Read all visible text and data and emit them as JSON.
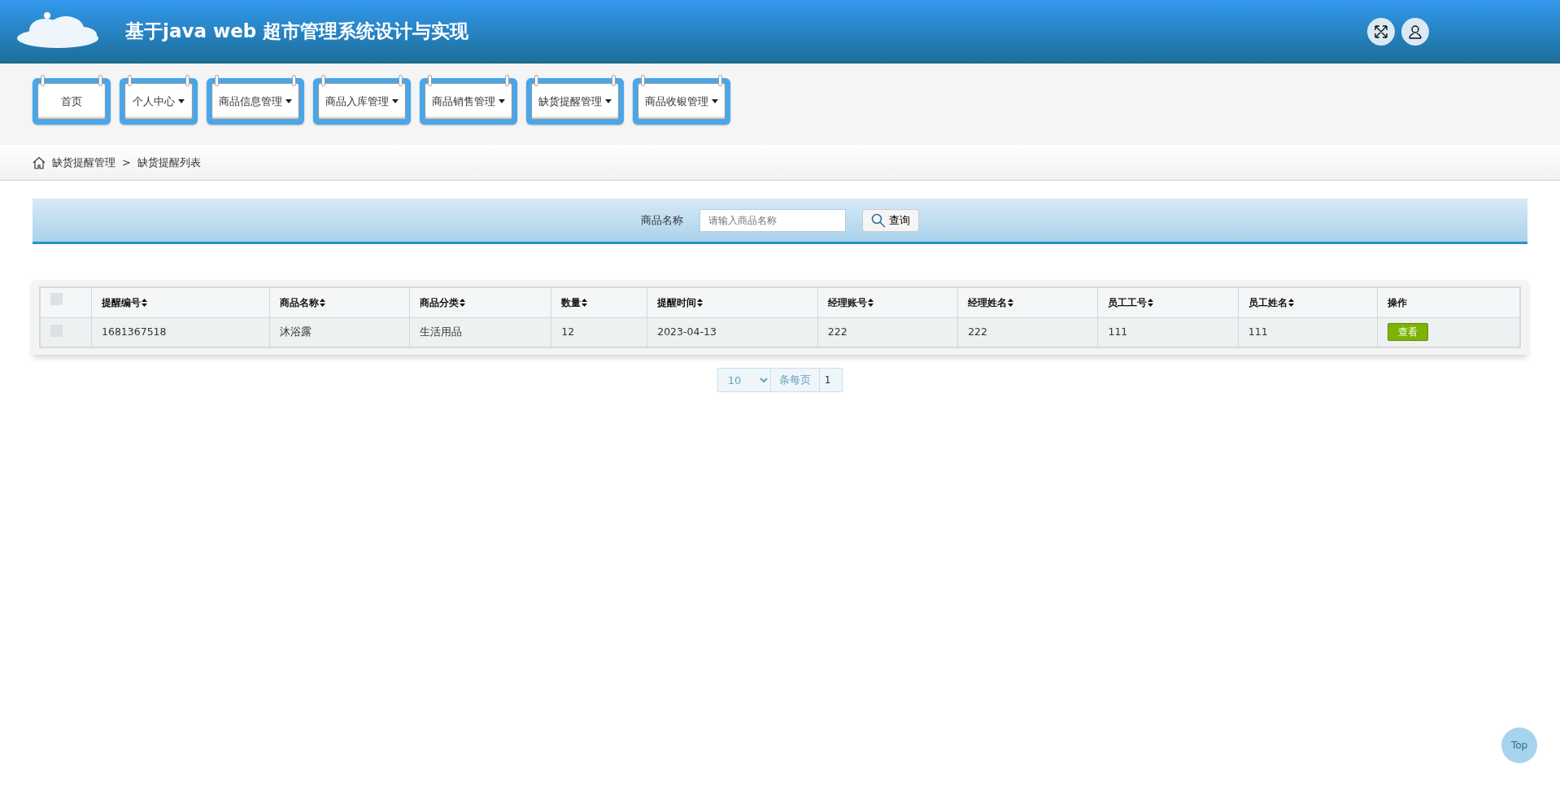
{
  "header": {
    "title": "基于java web 超市管理系统设计与实现"
  },
  "nav": {
    "items": [
      {
        "label": "首页",
        "dropdown": false
      },
      {
        "label": "个人中心",
        "dropdown": true
      },
      {
        "label": "商品信息管理",
        "dropdown": true
      },
      {
        "label": "商品入库管理",
        "dropdown": true
      },
      {
        "label": "商品销售管理",
        "dropdown": true
      },
      {
        "label": "缺货提醒管理",
        "dropdown": true
      },
      {
        "label": "商品收银管理",
        "dropdown": true
      }
    ]
  },
  "breadcrumb": {
    "items": [
      "缺货提醒管理",
      "缺货提醒列表"
    ],
    "separator": ">"
  },
  "search": {
    "label": "商品名称",
    "placeholder": "请输入商品名称",
    "button": "查询"
  },
  "table": {
    "select_all_checked": false,
    "columns": [
      {
        "label": "提醒编号",
        "sortable": true
      },
      {
        "label": "商品名称",
        "sortable": true
      },
      {
        "label": "商品分类",
        "sortable": true
      },
      {
        "label": "数量",
        "sortable": true
      },
      {
        "label": "提醒时间",
        "sortable": true
      },
      {
        "label": "经理账号",
        "sortable": true
      },
      {
        "label": "经理姓名",
        "sortable": true
      },
      {
        "label": "员工工号",
        "sortable": true
      },
      {
        "label": "员工姓名",
        "sortable": true
      },
      {
        "label": "操作",
        "sortable": false
      }
    ],
    "rows": [
      {
        "checked": false,
        "cells": [
          "1681367518",
          "沐浴露",
          "生活用品",
          "12",
          "2023-04-13",
          "222",
          "222",
          "111",
          "111"
        ],
        "action": "查看"
      }
    ]
  },
  "pagination": {
    "page_size": "10",
    "per_page_label": "条每页",
    "page": "1"
  },
  "top_button": "Top"
}
